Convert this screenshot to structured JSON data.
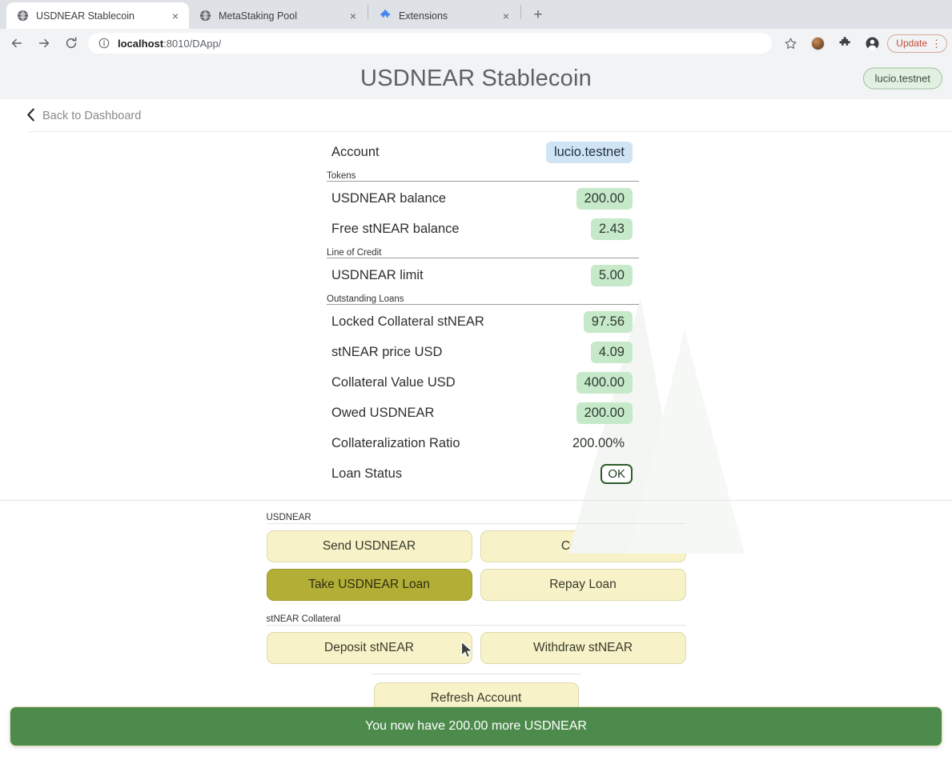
{
  "browser": {
    "tabs": [
      {
        "title": "USDNEAR Stablecoin",
        "icon": "globe-icon",
        "active": true,
        "close_label": "×"
      },
      {
        "title": "MetaStaking Pool",
        "icon": "globe-icon",
        "active": false,
        "close_label": "×"
      },
      {
        "title": "Extensions",
        "icon": "puzzle-icon",
        "active": false,
        "close_label": "×"
      }
    ],
    "new_tab_label": "+",
    "nav": {
      "back": "←",
      "forward": "→",
      "reload": "⟳"
    },
    "omnibox": {
      "host": "localhost",
      "path": ":8010/DApp/",
      "full_url": "localhost:8010/DApp/"
    },
    "toolbar_icons": [
      "star-icon",
      "profile-photo-icon",
      "extensions-puzzle-icon",
      "account-person-icon"
    ],
    "update_button": {
      "label": "Update",
      "dots": "⋮",
      "color": "#c5493a"
    }
  },
  "app": {
    "title": "USDNEAR Stablecoin",
    "account_pill": "lucio.testnet",
    "back_link": {
      "chevron": "‹",
      "label": "Back to Dashboard"
    }
  },
  "panel": {
    "account_row": {
      "label": "Account",
      "value": "lucio.testnet",
      "chip": "blue"
    },
    "sections": [
      {
        "name": "Tokens",
        "rows": [
          {
            "label": "USDNEAR balance",
            "value": "200.00",
            "chip": "green"
          },
          {
            "label": "Free stNEAR balance",
            "value": "2.43",
            "chip": "green"
          }
        ]
      },
      {
        "name": "Line of Credit",
        "rows": [
          {
            "label": "USDNEAR limit",
            "value": "5.00",
            "chip": "green"
          }
        ]
      },
      {
        "name": "Outstanding Loans",
        "rows": [
          {
            "label": "Locked Collateral stNEAR",
            "value": "97.56",
            "chip": "green"
          },
          {
            "label": "stNEAR price USD",
            "value": "4.09",
            "chip": "green"
          },
          {
            "label": "Collateral Value USD",
            "value": "400.00",
            "chip": "green"
          },
          {
            "label": "Owed USDNEAR",
            "value": "200.00",
            "chip": "green"
          },
          {
            "label": "Collateralization Ratio",
            "value": "200.00%",
            "chip": "none"
          },
          {
            "label": "Loan Status",
            "value": "OK",
            "chip": "status"
          }
        ]
      }
    ]
  },
  "actions": {
    "groups": [
      {
        "name": "USDNEAR",
        "rows": [
          [
            {
              "label": "Send USDNEAR",
              "state": "normal"
            },
            {
              "label": "Convert",
              "state": "normal"
            }
          ],
          [
            {
              "label": "Take USDNEAR Loan",
              "state": "active"
            },
            {
              "label": "Repay Loan",
              "state": "normal"
            }
          ]
        ]
      },
      {
        "name": "stNEAR Collateral",
        "rows": [
          [
            {
              "label": "Deposit stNEAR",
              "state": "normal"
            },
            {
              "label": "Withdraw stNEAR",
              "state": "normal"
            }
          ]
        ]
      }
    ],
    "refresh": {
      "label": "Refresh Account"
    }
  },
  "toast": {
    "message": "You now have 200.00 more USDNEAR",
    "background": "#4d8b4d",
    "text_color": "#ffffff"
  },
  "colors": {
    "chip_green": "#c6e9ca",
    "chip_blue": "#cfe4f5",
    "button_yellow": "#f7f2c8",
    "button_active_olive": "#b2ae36",
    "toast_green": "#4d8b4d",
    "header_grey": "#f2f3f4"
  }
}
